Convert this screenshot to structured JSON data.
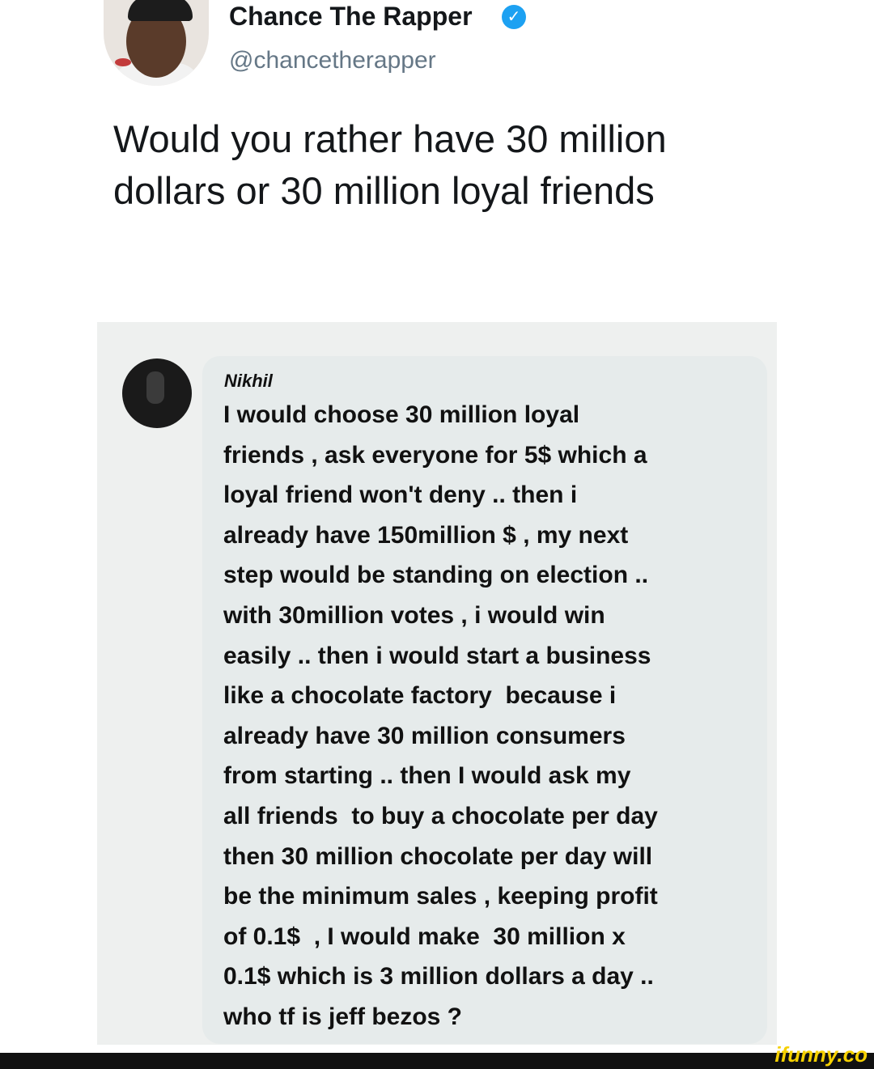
{
  "tweet": {
    "display_name": "Chance The Rapper",
    "handle": "@chancetherapper",
    "text": "Would you rather have 30 million dollars or 30 million loyal friends",
    "verified_icon": "verified-badge-icon"
  },
  "comment": {
    "author": "Nikhil",
    "text": "I would choose 30 million loyal\nfriends , ask everyone for 5$ which a\nloyal friend won't deny .. then i\nalready have 150million $ , my next\nstep would be standing on election ..\nwith 30million votes , i would win\neasily .. then i would start a business\nlike a chocolate factory  because i\nalready have 30 million consumers\nfrom starting .. then I would ask my\nall friends  to buy a chocolate per day\nthen 30 million chocolate per day will\nbe the minimum sales , keeping profit\nof 0.1$  , I would make  30 million x\n0.1$ which is 3 million dollars a day ..\nwho tf is jeff bezos ?"
  },
  "watermark": {
    "text": "ifunny.co"
  },
  "colors": {
    "verified_blue": "#1da1f2",
    "watermark_yellow": "#f5d000"
  }
}
